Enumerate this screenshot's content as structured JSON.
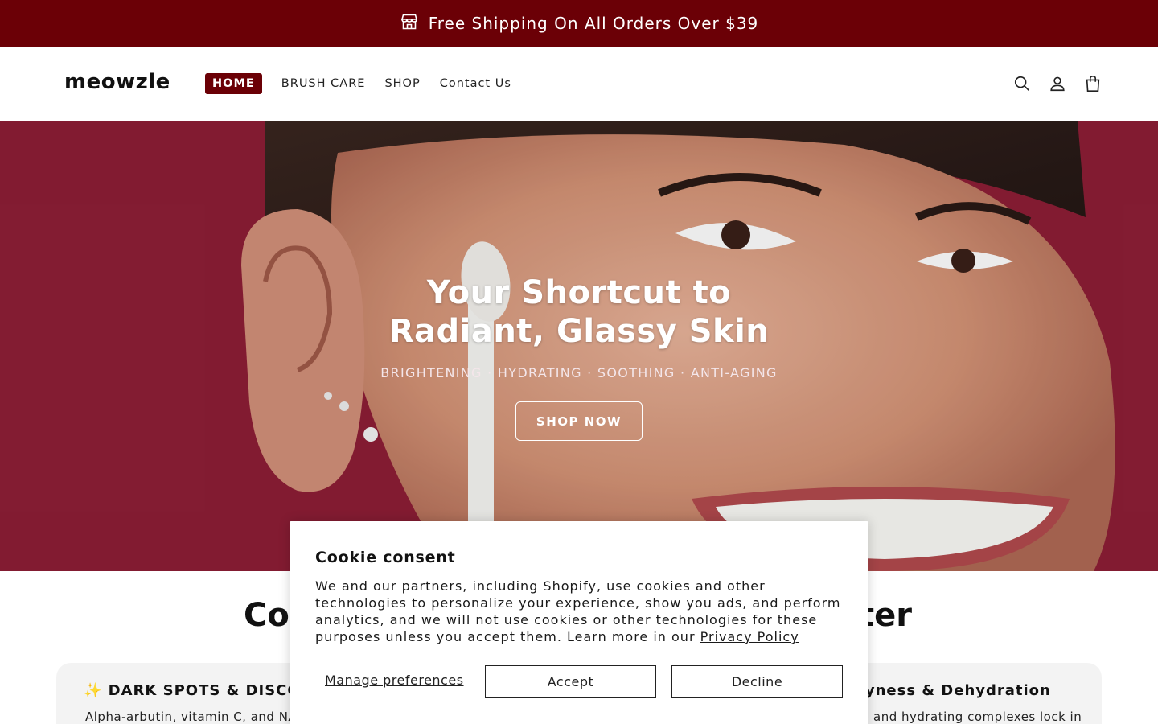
{
  "announcement": {
    "icon": "store-icon",
    "text": "Free Shipping On All Orders Over $39",
    "bg_color": "#6b0006"
  },
  "header": {
    "logo": "meowzle",
    "nav": [
      {
        "label": "HOME",
        "active": true
      },
      {
        "label": "BRUSH CARE",
        "active": false
      },
      {
        "label": "SHOP",
        "active": false
      },
      {
        "label": "Contact Us",
        "active": false
      }
    ],
    "icons": [
      "search-icon",
      "account-icon",
      "cart-icon"
    ]
  },
  "hero": {
    "title": "Your Shortcut to Radiant, Glassy Skin",
    "subtitle": "BRIGHTENING · HYDRATING · SOOTHING · ANTI-AGING",
    "cta": "SHOP NOW",
    "bg_color": "#8e1e36"
  },
  "section": {
    "title_left": "Co",
    "title_right": "ter",
    "card_left_title": "✨ DARK SPOTS & DISCOLO",
    "card_left_text": "Alpha-arbutin, vitamin C, and NA",
    "card_right_title": "ryness & Dehydration",
    "card_right_text": "and hydrating complexes lock in"
  },
  "cookie": {
    "title": "Cookie consent",
    "text": "We and our partners, including Shopify, use cookies and other technologies to personalize your experience, show you ads, and perform analytics, and we will not use cookies or other technologies for these purposes unless you accept them. Learn more in our",
    "link": "Privacy Policy",
    "manage": "Manage preferences",
    "accept": "Accept",
    "decline": "Decline"
  }
}
